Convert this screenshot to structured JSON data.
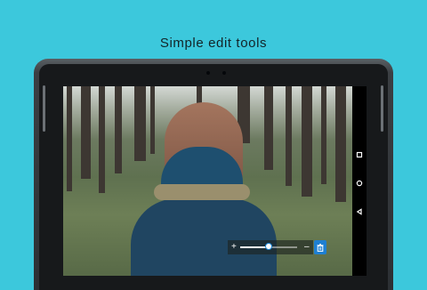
{
  "headline": "Simple edit tools",
  "slider": {
    "decrease_symbol": "–",
    "increase_symbol": "+",
    "value_fraction": 0.5
  },
  "icons": {
    "trash": "trash-icon",
    "recents": "square-icon",
    "home": "circle-icon",
    "back": "triangle-icon"
  },
  "colors": {
    "background": "#3cc8dc",
    "accent": "#1e7fd2"
  }
}
